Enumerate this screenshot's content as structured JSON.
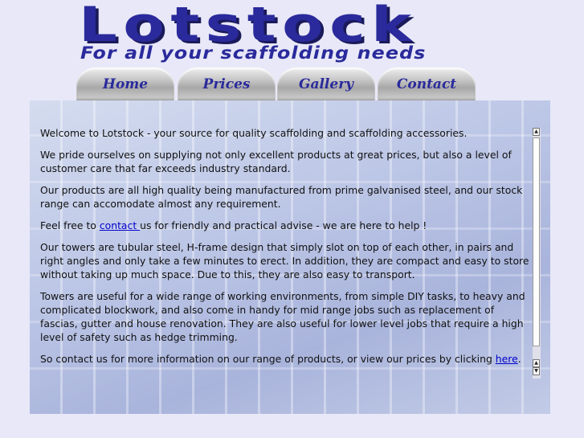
{
  "brand": {
    "name": "Lotstock",
    "tagline": "For all your scaffolding needs"
  },
  "nav": {
    "tabs": [
      {
        "label": "Home"
      },
      {
        "label": "Prices"
      },
      {
        "label": "Gallery"
      },
      {
        "label": "Contact"
      }
    ]
  },
  "content": {
    "p1": "Welcome to Lotstock - your source for quality scaffolding and scaffolding accessories.",
    "p2": "We pride ourselves on supplying not only excellent products at great prices, but also a level of customer care that far exceeds industry standard.",
    "p3": "Our products are all high quality being manufactured from prime galvanised steel, and our stock range can accomodate almost any requirement.",
    "p4_before": "Feel free to ",
    "p4_link": "contact ",
    "p4_after": "us for friendly and practical advise - we are here to help !",
    "p5": "Our towers are tubular steel, H-frame design that simply slot on top of each other, in pairs and right angles and only take a few minutes to erect. In addition, they are compact and easy to store without taking up much space. Due to this, they are also easy to transport.",
    "p6": "Towers are useful for a wide range of working environments, from simple DIY tasks, to heavy and complicated blockwork, and also come in handy for mid range jobs such as replacement of fascias, gutter and house renovation. They are also useful for lower level jobs that require a high level of safety such as hedge trimming.",
    "p7_before": "So contact us for more information on our range of products, or view our prices by clicking ",
    "p7_link": "here",
    "p7_after": "."
  },
  "scrollbar": {
    "up_glyph": "▲",
    "down_glyph": "▼"
  },
  "colors": {
    "brand": "#2a2a9c",
    "link": "#0000cc",
    "page_background": "#e8e8f8"
  }
}
